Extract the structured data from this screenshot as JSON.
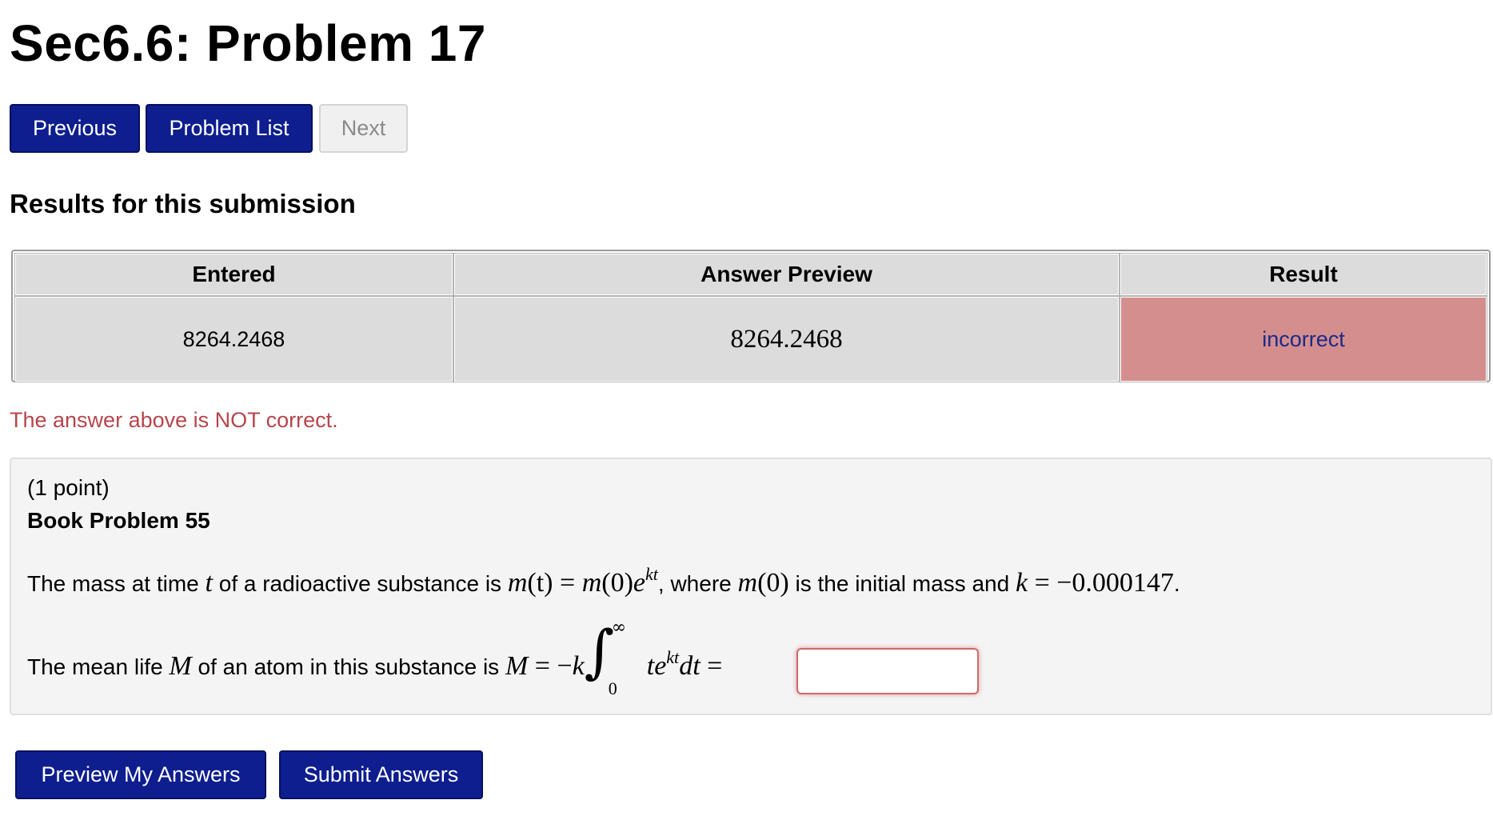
{
  "page": {
    "title": "Sec6.6: Problem 17"
  },
  "nav": {
    "previous_label": "Previous",
    "problem_list_label": "Problem List",
    "next_label": "Next"
  },
  "results": {
    "heading": "Results for this submission",
    "columns": [
      "Entered",
      "Answer Preview",
      "Result"
    ],
    "rows": [
      {
        "entered": "8264.2468",
        "preview": "8264.2468",
        "result": "incorrect"
      }
    ],
    "feedback": "The answer above is NOT correct."
  },
  "problem": {
    "points": "(1 point)",
    "book_problem": "Book Problem 55",
    "line1": {
      "t1": "The mass at time ",
      "var_t": "t",
      "t2": " of a radioactive substance is ",
      "m_t": "m",
      "paren_t": "(t)",
      "eq1": " = ",
      "m0": "m",
      "paren0": "(0)",
      "e": "e",
      "kt": "kt",
      "t3": ", where ",
      "m0b": "m",
      "paren0b": "(0)",
      "t4": " is the initial mass and ",
      "k": "k",
      "eq2": " = −0.000147",
      "t5": "."
    },
    "line2": {
      "t1": "The mean life ",
      "M": "M",
      "t2": " of an atom in this substance is ",
      "M2": "M",
      "eq": " = −",
      "k": "k",
      "upper": "∞",
      "lower": "0",
      "te": "te",
      "kt": "kt",
      "dt": "dt",
      "eq2": " = "
    },
    "answer_value": "",
    "answer_placeholder": ""
  },
  "actions": {
    "preview_label": "Preview My Answers",
    "submit_label": "Submit Answers"
  },
  "colors": {
    "primary_button": "#0e1e8f",
    "incorrect_bg": "#d58e8e",
    "incorrect_text": "#1a2a8a",
    "feedback_text": "#b5464c"
  }
}
